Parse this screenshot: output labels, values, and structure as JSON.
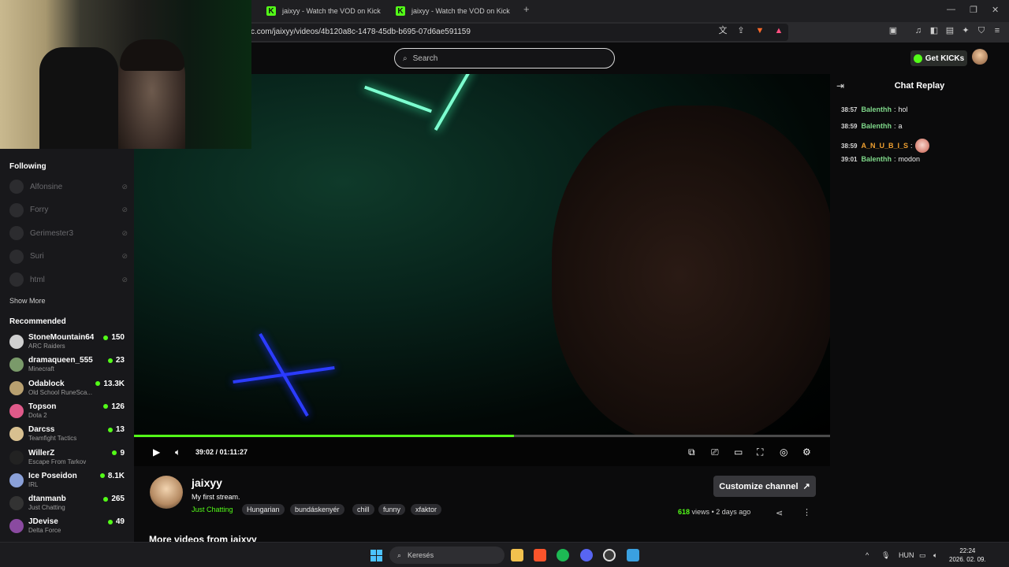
{
  "browser": {
    "tabs": [
      {
        "title": "jaixyy - Watch the VOD on Kick"
      },
      {
        "title": "jaixyy - Watch the VOD on Kick"
      }
    ],
    "new_tab_icon": "plus-icon",
    "url": "c.com/jaixyy/videos/4b120a8c-1478-45db-b695-07d6ae591159"
  },
  "header": {
    "search_placeholder": "Search",
    "get_kicks_label": "Get KICKs"
  },
  "sidebar": {
    "following_title": "Following",
    "following": [
      {
        "name": "Alfonsine"
      },
      {
        "name": "Forry"
      },
      {
        "name": "Gerimester3"
      },
      {
        "name": "Suri"
      },
      {
        "name": "html"
      }
    ],
    "show_more_label": "Show More",
    "recommended_title": "Recommended",
    "recommended": [
      {
        "name": "StoneMountain64",
        "category": "ARC Raiders",
        "viewers": "150",
        "color": "#cfcfcf"
      },
      {
        "name": "dramaqueen_555",
        "category": "Minecraft",
        "viewers": "23",
        "color": "#7a9a6a"
      },
      {
        "name": "Odablock",
        "category": "Old School RuneSca...",
        "viewers": "13.3K",
        "color": "#b8a070"
      },
      {
        "name": "Topson",
        "category": "Dota 2",
        "viewers": "126",
        "color": "#e05a8a"
      },
      {
        "name": "Darcss",
        "category": "Teamfight Tactics",
        "viewers": "13",
        "color": "#d8c090"
      },
      {
        "name": "WillerZ",
        "category": "Escape From Tarkov",
        "viewers": "9",
        "color": "#222222"
      },
      {
        "name": "Ice Poseidon",
        "category": "IRL",
        "viewers": "8.1K",
        "color": "#8aa0d8"
      },
      {
        "name": "dtanmanb",
        "category": "Just Chatting",
        "viewers": "265",
        "color": "#333333"
      },
      {
        "name": "JDevise",
        "category": "Delta Force",
        "viewers": "49",
        "color": "#8a4aa0"
      }
    ]
  },
  "player": {
    "time": "39:02 / 01:11:27",
    "progress_fraction": 0.546
  },
  "channel": {
    "name": "jaixyy",
    "title": "My first stream.",
    "category": "Just Chatting",
    "tags": [
      "Hungarian",
      "bundáskenyér",
      "chill",
      "funny",
      "xfaktor"
    ],
    "customize_label": "Customize channel",
    "views": "618",
    "views_label": "views",
    "separator": "•",
    "date": "2 days ago",
    "more_videos": "More videos from jaixyy"
  },
  "chat": {
    "title": "Chat Replay",
    "messages": [
      {
        "time": "38:57",
        "user": "Balenthh",
        "text": "hol",
        "color": "#7fd88a"
      },
      {
        "time": "38:59",
        "user": "Balenthh",
        "text": "a",
        "color": "#7fd88a"
      },
      {
        "time": "38:59",
        "user": "A_N_U_B_I_S",
        "text": "",
        "color": "#f0a030",
        "emote": true
      },
      {
        "time": "39:01",
        "user": "Balenthh",
        "text": "modon",
        "color": "#7fd88a"
      }
    ]
  },
  "taskbar": {
    "search_label": "Keresés",
    "language": "HUN",
    "time": "22:24",
    "date": "2026. 02. 09."
  }
}
